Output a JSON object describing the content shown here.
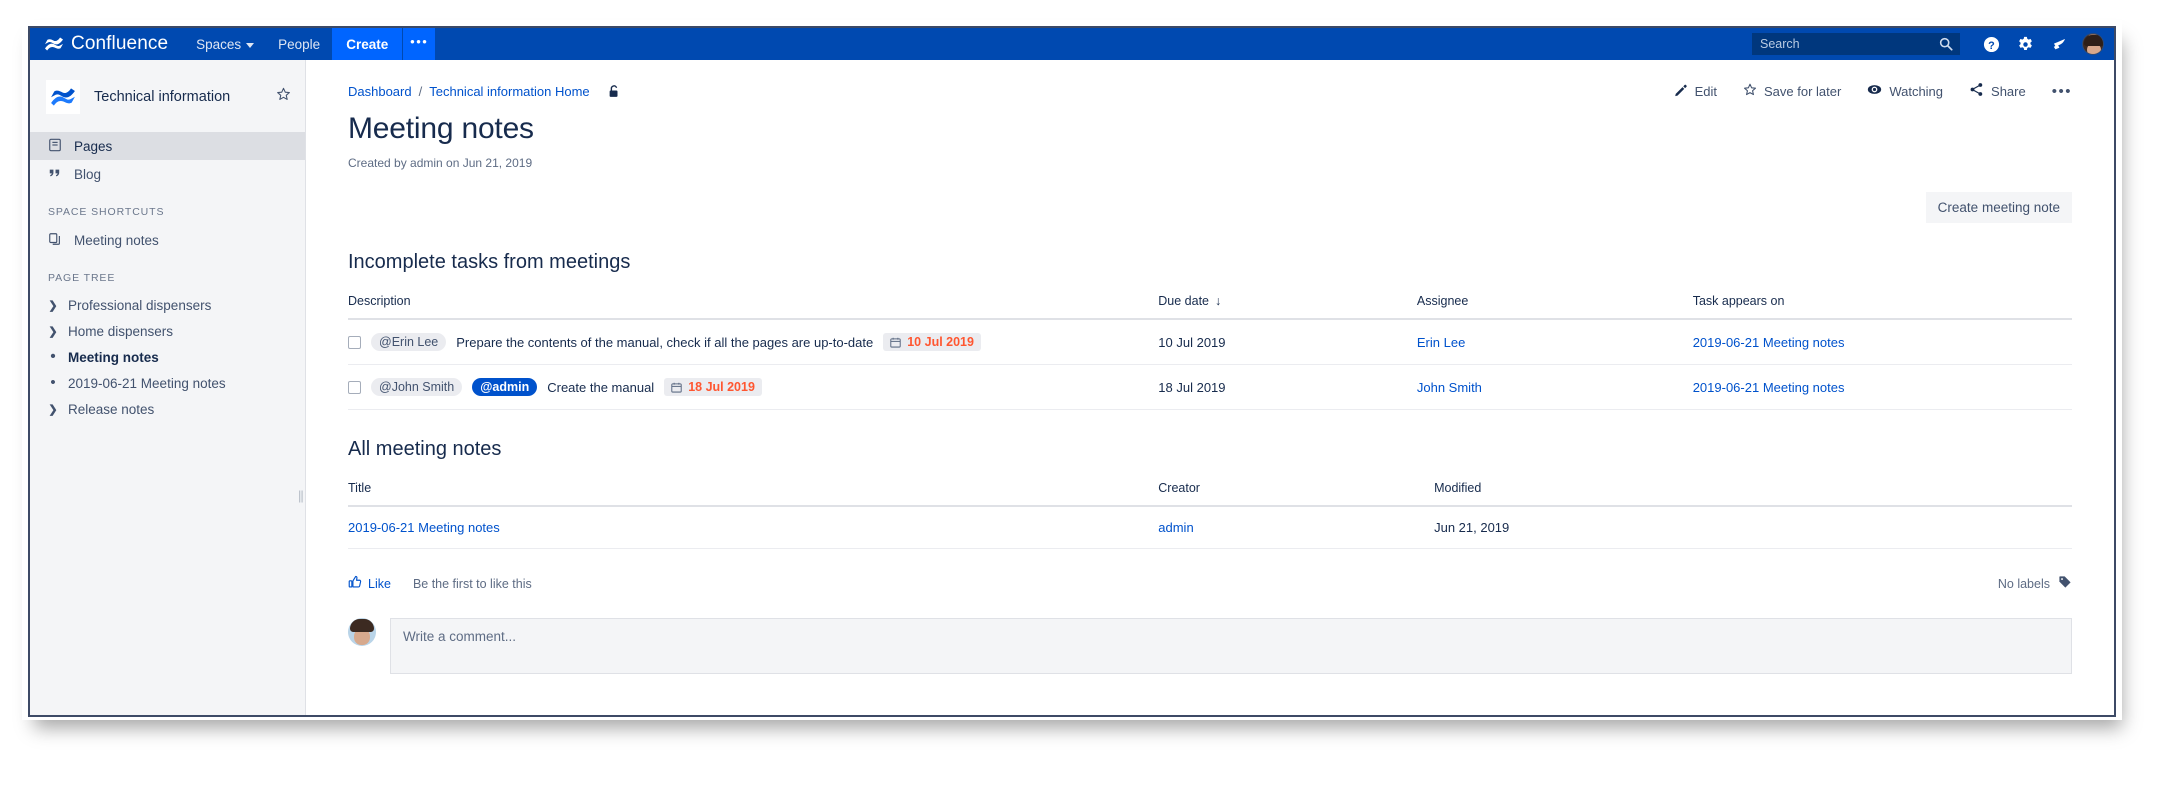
{
  "topnav": {
    "brand": "Confluence",
    "spaces_label": "Spaces",
    "people_label": "People",
    "create_label": "Create",
    "more_label": "•••",
    "search_placeholder": "Search",
    "help_icon": "help-icon",
    "settings_icon": "gear-icon",
    "notifications_icon": "bell-icon",
    "avatar_icon": "avatar"
  },
  "sidebar": {
    "space_name": "Technical information",
    "star_icon": "star-icon",
    "primary": [
      {
        "label": "Pages",
        "icon": "page-icon",
        "active": true
      },
      {
        "label": "Blog",
        "icon": "quote-icon",
        "active": false
      }
    ],
    "shortcuts_heading": "SPACE SHORTCUTS",
    "shortcuts": [
      {
        "label": "Meeting notes",
        "icon": "copy-icon"
      }
    ],
    "tree_heading": "PAGE TREE",
    "tree": [
      {
        "label": "Professional dispensers",
        "marker": "chevron",
        "current": false
      },
      {
        "label": "Home dispensers",
        "marker": "chevron",
        "current": false
      },
      {
        "label": "Meeting notes",
        "marker": "dot",
        "current": true
      },
      {
        "label": "2019-06-21 Meeting notes",
        "marker": "dot",
        "current": false
      },
      {
        "label": "Release notes",
        "marker": "chevron",
        "current": false
      }
    ]
  },
  "breadcrumb": {
    "items": [
      "Dashboard",
      "Technical information Home"
    ],
    "separator": "/",
    "restrictions_icon": "unlock-icon"
  },
  "page_actions": [
    {
      "label": "Edit",
      "icon": "pencil-icon",
      "accesskey": "E"
    },
    {
      "label": "Save for later",
      "icon": "star-icon",
      "accesskey": "f"
    },
    {
      "label": "Watching",
      "icon": "eye-icon",
      "accesskey": "W"
    },
    {
      "label": "Share",
      "icon": "share-icon",
      "accesskey": "S"
    }
  ],
  "page_actions_more": "•••",
  "page": {
    "title": "Meeting notes",
    "byline": "Created by admin on Jun 21, 2019",
    "create_note_button": "Create meeting note"
  },
  "tasks_section": {
    "heading": "Incomplete tasks from meetings",
    "columns": [
      "Description",
      "Due date",
      "Assignee",
      "Task appears on"
    ],
    "sort_column": "Due date",
    "sort_arrow": "↓",
    "rows": [
      {
        "mentions": [
          {
            "name": "@Erin Lee",
            "current_user": false
          }
        ],
        "text": "Prepare the contents of the manual, check if all the pages are up-to-date",
        "inline_date": "10 Jul 2019",
        "due_date": "10 Jul 2019",
        "assignee": "Erin Lee",
        "appears_on": "2019-06-21 Meeting notes"
      },
      {
        "mentions": [
          {
            "name": "@John Smith",
            "current_user": false
          },
          {
            "name": "@admin",
            "current_user": true
          }
        ],
        "text": "Create the manual",
        "inline_date": "18 Jul 2019",
        "due_date": "18 Jul 2019",
        "assignee": "John Smith",
        "appears_on": "2019-06-21 Meeting notes"
      }
    ]
  },
  "notes_section": {
    "heading": "All meeting notes",
    "columns": [
      "Title",
      "Creator",
      "Modified"
    ],
    "rows": [
      {
        "title": "2019-06-21 Meeting notes",
        "creator": "admin",
        "modified": "Jun 21, 2019"
      }
    ]
  },
  "footer": {
    "like_label": "Like",
    "like_icon": "thumbs-up-icon",
    "like_note": "Be the first to like this",
    "labels_text": "No labels",
    "labels_icon": "tag-icon"
  },
  "comment": {
    "placeholder": "Write a comment...",
    "avatar_icon": "avatar"
  },
  "colors": {
    "nav_blue": "#0049b0",
    "create_blue": "#0065ff",
    "link_blue": "#0052cc",
    "mention_blue": "#0052cc",
    "overdue_red": "#ff5630",
    "sidebar_bg": "#f4f5f7"
  }
}
